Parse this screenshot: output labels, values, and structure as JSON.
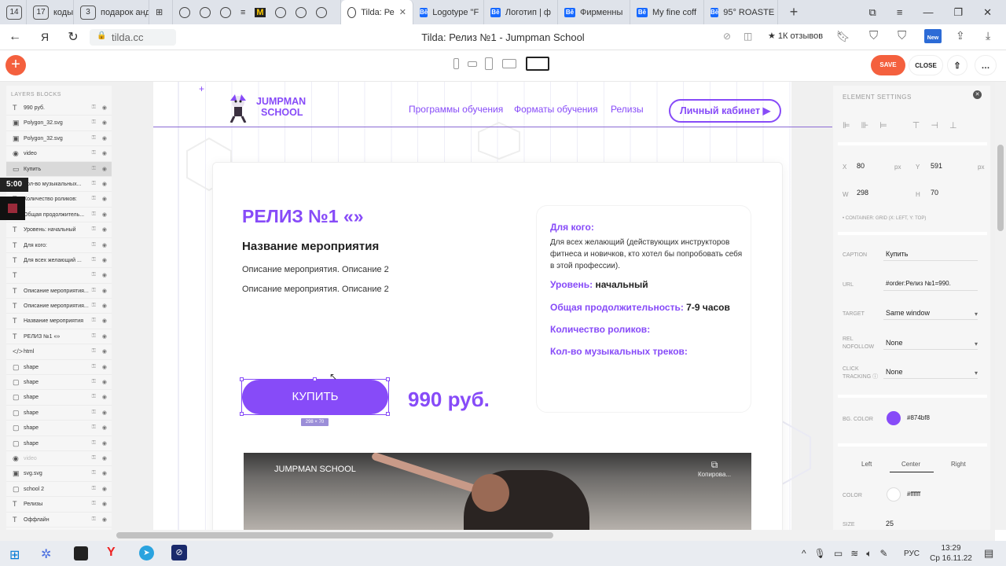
{
  "browser": {
    "tabs": [
      {
        "label": "14",
        "kind": "badge"
      },
      {
        "label": "17",
        "kind": "badge"
      },
      {
        "label": "коды",
        "kind": "text"
      },
      {
        "label": "3",
        "kind": "badge"
      },
      {
        "label": "подарок андр",
        "kind": "text"
      },
      {
        "label": "Tilda: Ре",
        "kind": "active"
      },
      {
        "label": "Logotype \"F",
        "kind": "be"
      },
      {
        "label": "Логотип | ф",
        "kind": "be"
      },
      {
        "label": "Фирменны",
        "kind": "be"
      },
      {
        "label": "My fine coff",
        "kind": "be"
      },
      {
        "label": "95° ROASTE",
        "kind": "be"
      }
    ],
    "url": "tilda.cc",
    "page_title": "Tilda: Релиз №1 - Jumpman School",
    "reviews": "★ 1К отзывов",
    "new_badge": "New"
  },
  "editor": {
    "save_label": "SAVE",
    "close_label": "CLOSE"
  },
  "recorder": {
    "timer": "5:00"
  },
  "layers": {
    "tabs": "LAYERS   BLOCKS",
    "items": [
      {
        "label": "990 руб.",
        "icon": "T"
      },
      {
        "label": "Polygon_32.svg",
        "icon": "▣"
      },
      {
        "label": "Polygon_32.svg",
        "icon": "▣"
      },
      {
        "label": "video",
        "icon": "◉"
      },
      {
        "label": "Купить",
        "icon": "▭",
        "selected": true
      },
      {
        "label": "Кол-во музыкальных...",
        "icon": "T"
      },
      {
        "label": "Количество роликов:",
        "icon": "T"
      },
      {
        "label": "Общая продолжитель...",
        "icon": "T"
      },
      {
        "label": "Уровень: начальный",
        "icon": "T"
      },
      {
        "label": "Для кого:",
        "icon": "T"
      },
      {
        "label": "Для всех желающий ...",
        "icon": "T"
      },
      {
        "label": "",
        "icon": "T"
      },
      {
        "label": "Описание мероприятия...",
        "icon": "T"
      },
      {
        "label": "Описание мероприятия...",
        "icon": "T"
      },
      {
        "label": "Название мероприятия",
        "icon": "T"
      },
      {
        "label": "РЕЛИЗ №1 «»",
        "icon": "T"
      },
      {
        "label": "html",
        "icon": "</>"
      },
      {
        "label": "shape",
        "icon": "▢"
      },
      {
        "label": "shape",
        "icon": "▢"
      },
      {
        "label": "shape",
        "icon": "▢"
      },
      {
        "label": "shape",
        "icon": "▢"
      },
      {
        "label": "shape",
        "icon": "▢"
      },
      {
        "label": "shape",
        "icon": "▢"
      },
      {
        "label": "video",
        "icon": "◉",
        "dim": true
      },
      {
        "label": "svg.svg",
        "icon": "▣"
      },
      {
        "label": "school 2",
        "icon": "▢"
      },
      {
        "label": "Релизы",
        "icon": "T"
      },
      {
        "label": "Оффлайн",
        "icon": "T"
      }
    ]
  },
  "site": {
    "logo_line1": "JUMPMAN",
    "logo_line2": "SCHOOL",
    "menu": [
      "Программы обучения",
      "Форматы обучения",
      "Релизы"
    ],
    "cabinet": "Личный кабинет ▶",
    "release_title": "РЕЛИЗ №1 «»",
    "event_name": "Название мероприятия",
    "desc1": "Описание мероприятия. Описание 2",
    "desc2": "Описание мероприятия. Описание 2",
    "buy_label": "КУПИТЬ",
    "buy_size": "298 × 70",
    "price": "990 руб.",
    "for_whom_label": "Для кого:",
    "for_whom_text": "Для всех желающий (действующих инструкторов фитнеса и новичков, кто хотел бы попробовать себя в этой профессии).",
    "level_label": "Уровень:",
    "level_value": "начальный",
    "duration_label": "Общая продолжительность:",
    "duration_value": "7-9 часов",
    "videos_label": "Количество роликов:",
    "tracks_label": "Кол-во музыкальных треков:",
    "video_title": "JUMPMAN SCHOOL",
    "video_copy": "Копирова..."
  },
  "settings": {
    "title": "ELEMENT SETTINGS",
    "x_label": "X",
    "x": "80",
    "x_unit": "px",
    "y_label": "Y",
    "y": "591",
    "y_unit": "px",
    "w_label": "W",
    "w": "298",
    "h_label": "H",
    "h": "70",
    "container": "• CONTAINER: GRID (X: LEFT, Y: TOP)",
    "caption_label": "CAPTION",
    "caption": "Купить",
    "url_label": "URL",
    "url": "#order:Релиз №1=990.",
    "target_label": "TARGET",
    "target": "Same window",
    "rel_label1": "REL",
    "rel_label2": "NOFOLLOW",
    "rel": "None",
    "click_label1": "CLICK",
    "click_label2": "TRACKING",
    "click": "None",
    "bg_label": "BG. COLOR",
    "bg": "#874bf8",
    "align_left": "Left",
    "align_center": "Center",
    "align_right": "Right",
    "color_label": "COLOR",
    "color": "#ffffff",
    "size_label": "SIZE",
    "size": "25"
  },
  "taskbar": {
    "lang": "РУС",
    "time": "13:29",
    "date": "Ср 16.11.22"
  },
  "colors": {
    "accent": "#874bf8",
    "tilda_orange": "#f4603e",
    "save_red": "#f4603e"
  }
}
